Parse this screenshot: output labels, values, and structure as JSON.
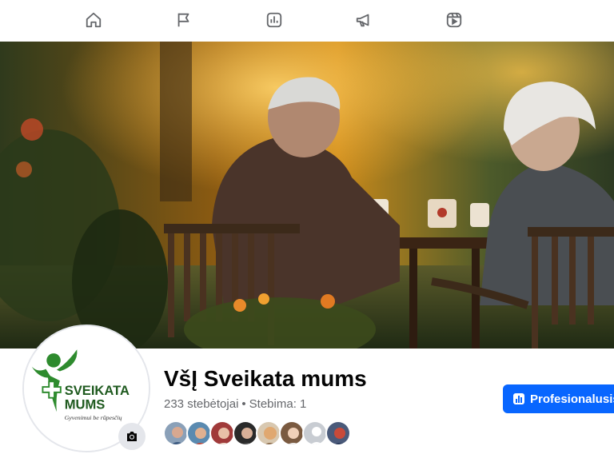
{
  "nav": {
    "items": [
      {
        "icon": "home-icon"
      },
      {
        "icon": "flag-icon"
      },
      {
        "icon": "bar-chart-icon"
      },
      {
        "icon": "megaphone-icon"
      },
      {
        "icon": "reels-icon"
      }
    ]
  },
  "cover": {
    "description_icon": "cover-photo"
  },
  "avatar": {
    "logo_line1": "SVEIKATA",
    "logo_line2": "MUMS",
    "logo_tagline": "Gyvenimui be rūpesčių",
    "brand_color": "#2e8b2e"
  },
  "page": {
    "name": "VšĮ Sveikata mums",
    "followers_text": "233 stebėtojai",
    "separator": "•",
    "following_text": "Stebima: 1"
  },
  "followers_preview": {
    "count_shown": 8
  },
  "actions": {
    "pro_button_label": "Profesionalusis v",
    "accent_color": "#0866ff"
  }
}
